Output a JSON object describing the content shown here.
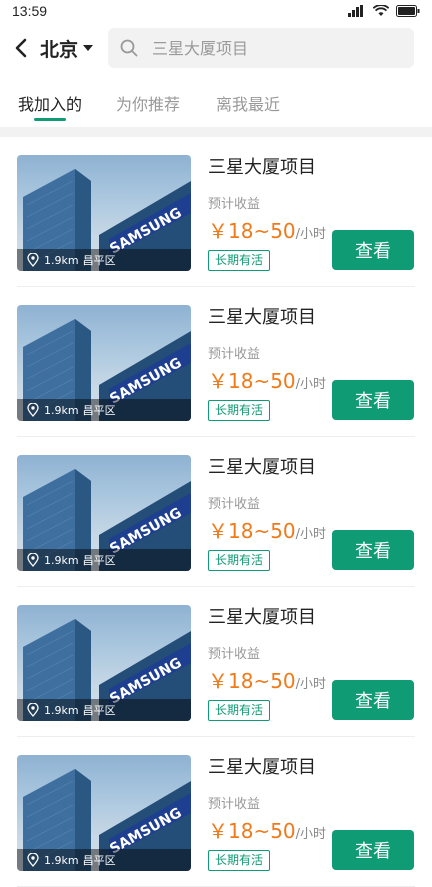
{
  "status_bar": {
    "time": "13:59"
  },
  "header": {
    "city": "北京",
    "search_placeholder": "三星大厦项目"
  },
  "tabs": [
    {
      "label": "我加入的",
      "active": true
    },
    {
      "label": "为你推荐",
      "active": false
    },
    {
      "label": "离我最近",
      "active": false
    }
  ],
  "colors": {
    "accent": "#0f9b74",
    "price": "#ef7a1a"
  },
  "jobs": [
    {
      "title": "三星大厦项目",
      "distance": "1.9km",
      "district": "昌平区",
      "earnings_label": "预计收益",
      "price": "￥18~50",
      "unit": "/小时",
      "tag": "长期有活",
      "button": "查看",
      "image_sign": "SAMSUNG"
    },
    {
      "title": "三星大厦项目",
      "distance": "1.9km",
      "district": "昌平区",
      "earnings_label": "预计收益",
      "price": "￥18~50",
      "unit": "/小时",
      "tag": "长期有活",
      "button": "查看",
      "image_sign": "SAMSUNG"
    },
    {
      "title": "三星大厦项目",
      "distance": "1.9km",
      "district": "昌平区",
      "earnings_label": "预计收益",
      "price": "￥18~50",
      "unit": "/小时",
      "tag": "长期有活",
      "button": "查看",
      "image_sign": "SAMSUNG"
    },
    {
      "title": "三星大厦项目",
      "distance": "1.9km",
      "district": "昌平区",
      "earnings_label": "预计收益",
      "price": "￥18~50",
      "unit": "/小时",
      "tag": "长期有活",
      "button": "查看",
      "image_sign": "SAMSUNG"
    },
    {
      "title": "三星大厦项目",
      "distance": "1.9km",
      "district": "昌平区",
      "earnings_label": "预计收益",
      "price": "￥18~50",
      "unit": "/小时",
      "tag": "长期有活",
      "button": "查看",
      "image_sign": "SAMSUNG"
    }
  ]
}
